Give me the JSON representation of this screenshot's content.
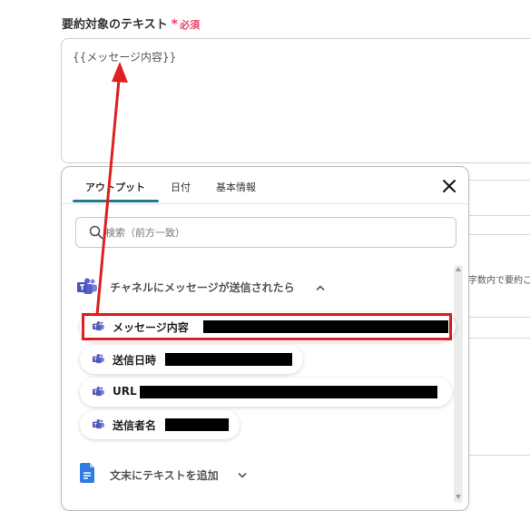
{
  "field": {
    "label": "要約対象のテキスト",
    "required_star": "*",
    "required_text": "必須",
    "value": "{{メッセージ内容}}"
  },
  "background": {
    "fragment_text": "字数内で要約こ"
  },
  "popup": {
    "tabs": [
      {
        "label": "アウトプット",
        "active": true
      },
      {
        "label": "日付",
        "active": false
      },
      {
        "label": "基本情報",
        "active": false
      }
    ],
    "search": {
      "placeholder": "検索（前方一致）"
    },
    "sections": [
      {
        "title": "チャネルにメッセージが送信されたら",
        "icon": "teams-icon",
        "expanded": true,
        "items": [
          {
            "label": "メッセージ内容",
            "value": "[redacted]"
          },
          {
            "label": "送信日時",
            "value": "[redacted]"
          },
          {
            "label": "URL",
            "value": "[redacted]"
          },
          {
            "label": "送信者名",
            "value": "[redacted]"
          }
        ]
      },
      {
        "title": "文末にテキストを追加",
        "icon": "document-icon",
        "expanded": false
      }
    ]
  },
  "colors": {
    "accent": "#1f7a8c",
    "required": "#e5466b",
    "annotation": "#e02020",
    "teams": "#5b5fc7",
    "doc": "#2f7be5"
  }
}
